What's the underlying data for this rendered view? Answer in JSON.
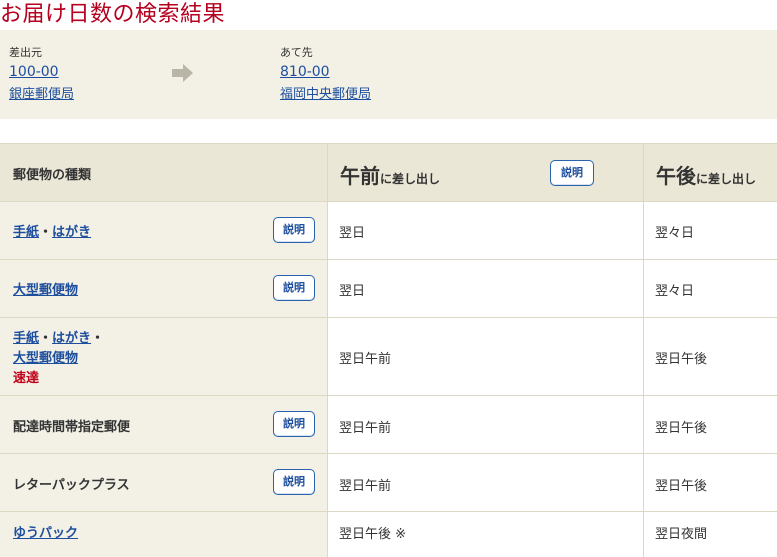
{
  "page": {
    "title": "お届け日数の検索結果"
  },
  "route": {
    "from": {
      "label": "差出元",
      "zip": "100-00",
      "office": "銀座郵便局"
    },
    "to": {
      "label": "あて先",
      "zip": "810-00",
      "office": "福岡中央郵便局"
    }
  },
  "table": {
    "header": {
      "type_label": "郵便物の種類",
      "am_big": "午前",
      "am_small": "に差し出し",
      "pm_big": "午後",
      "pm_small": "に差し出し",
      "explain_label": "説明"
    },
    "rows": [
      {
        "links": [
          "手紙",
          "はがき"
        ],
        "am": "翌日",
        "pm": "翌々日",
        "explain": "説明"
      },
      {
        "links": [
          "大型郵便物"
        ],
        "am": "翌日",
        "pm": "翌々日",
        "explain": "説明"
      },
      {
        "line1": [
          "手紙",
          "はがき"
        ],
        "line2": "大型郵便物",
        "line3": "速達",
        "am": "翌日午前",
        "pm": "翌日午後"
      },
      {
        "text": "配達時間帯指定郵便",
        "am": "翌日午前",
        "pm": "翌日午後",
        "explain": "説明"
      },
      {
        "text": "レターパックプラス",
        "am": "翌日午前",
        "pm": "翌日午後",
        "explain": "説明"
      },
      {
        "links": [
          "ゆうパック"
        ],
        "am": "翌日午後 ※",
        "pm": "翌日夜間"
      }
    ],
    "separator": "・"
  },
  "colors": {
    "title": "#b5001f",
    "link": "#1d4e9e",
    "panel": "#f3f1e6",
    "header": "#ebe7d6",
    "accent_red": "#c0001a"
  },
  "icons": {
    "route_arrow": "right-arrow-icon"
  }
}
